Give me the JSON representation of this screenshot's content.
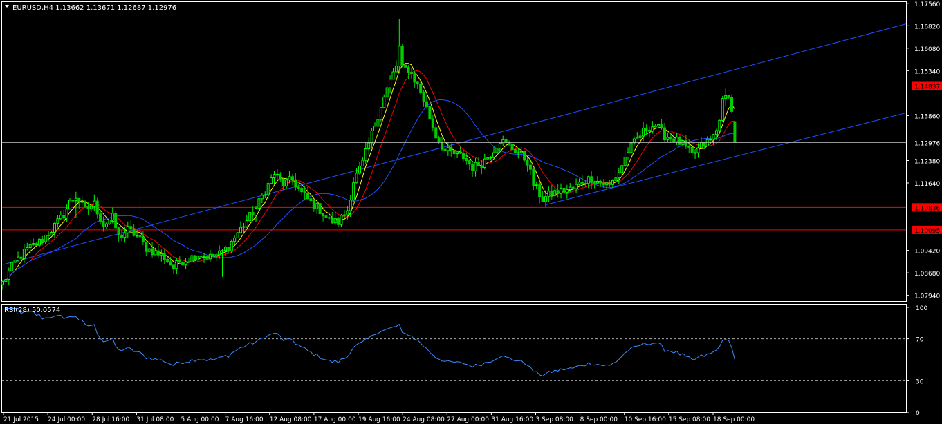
{
  "window": {
    "header_text": "EURUSD,H4  1.13662 1.13671 1.12687 1.12976",
    "rsi_header": "RSI(28) 50.0574"
  },
  "colors": {
    "background": "#000000",
    "frame": "#ffffff",
    "bull_bar": "#00ff00",
    "bear_bar": "#00cc00",
    "ma_fast": "#ffff00",
    "ma_mid": "#ff0000",
    "ma_slow": "#1e50ff",
    "hline": "#ff0000",
    "trendline": "#1e50ff",
    "rsi_line": "#3c8cff",
    "current_price_line": "#c8c8c8",
    "price_tag_bg": "#ff0000"
  },
  "chart_data": [
    {
      "type": "candlestick",
      "title": "EURUSD,H4",
      "symbol": "EURUSD",
      "timeframe": "H4",
      "ohlc_last": {
        "open": 1.13662,
        "high": 1.13671,
        "low": 1.12687,
        "close": 1.12976
      },
      "ylim": [
        1.0775,
        1.176
      ],
      "y_ticks": [
        1.1756,
        1.1682,
        1.1608,
        1.1534,
        1.1386,
        1.1238,
        1.1164,
        1.0942,
        1.0868,
        1.0794
      ],
      "y_tick_labels": [
        "1.17560",
        "1.16820",
        "1.16080",
        "1.15340",
        "1.13860",
        "1.12380",
        "1.11640",
        "1.09420",
        "1.08680",
        "1.07940"
      ],
      "x_tick_labels": [
        "21 Jul 2015",
        "24 Jul 00:00",
        "28 Jul 16:00",
        "31 Jul 08:00",
        "5 Aug 00:00",
        "7 Aug 16:00",
        "12 Aug 08:00",
        "17 Aug 00:00",
        "19 Aug 16:00",
        "24 Aug 08:00",
        "27 Aug 00:00",
        "31 Aug 16:00",
        "3 Sep 08:00",
        "8 Sep 00:00",
        "10 Sep 16:00",
        "15 Sep 08:00",
        "18 Sep 00:00"
      ],
      "horizontal_levels": [
        {
          "value": 1.14837,
          "label": "1.14837"
        },
        {
          "value": 1.10836,
          "label": "1.10836"
        },
        {
          "value": 1.10095,
          "label": "1.10095"
        }
      ],
      "current_price": {
        "value": 1.12976,
        "label": "1.12976"
      },
      "grid": false,
      "price_path": [
        [
          0,
          1.0835
        ],
        [
          4,
          1.0905
        ],
        [
          8,
          1.0945
        ],
        [
          12,
          1.097
        ],
        [
          16,
          1.101
        ],
        [
          20,
          1.106
        ],
        [
          22,
          1.11
        ],
        [
          24,
          1.112
        ],
        [
          27,
          1.1075
        ],
        [
          30,
          1.1095
        ],
        [
          33,
          1.1025
        ],
        [
          36,
          1.105
        ],
        [
          38,
          1.0985
        ],
        [
          41,
          1.101
        ],
        [
          44,
          1.099
        ],
        [
          47,
          1.095
        ],
        [
          50,
          1.0935
        ],
        [
          53,
          1.092
        ],
        [
          56,
          1.0885
        ],
        [
          58,
          1.0905
        ],
        [
          61,
          1.0915
        ],
        [
          64,
          1.093
        ],
        [
          68,
          1.092
        ],
        [
          71,
          1.093
        ],
        [
          74,
          1.0955
        ],
        [
          77,
          1.1
        ],
        [
          80,
          1.104
        ],
        [
          83,
          1.108
        ],
        [
          86,
          1.114
        ],
        [
          89,
          1.1195
        ],
        [
          92,
          1.116
        ],
        [
          95,
          1.1175
        ],
        [
          98,
          1.113
        ],
        [
          101,
          1.11
        ],
        [
          104,
          1.1075
        ],
        [
          107,
          1.104
        ],
        [
          110,
          1.1035
        ],
        [
          113,
          1.1075
        ],
        [
          115,
          1.117
        ],
        [
          118,
          1.123
        ],
        [
          121,
          1.1325
        ],
        [
          124,
          1.142
        ],
        [
          127,
          1.15
        ],
        [
          129,
          1.155
        ],
        [
          130,
          1.161
        ],
        [
          131,
          1.154
        ],
        [
          133,
          1.154
        ],
        [
          135,
          1.1505
        ],
        [
          137,
          1.1465
        ],
        [
          139,
          1.141
        ],
        [
          142,
          1.132
        ],
        [
          145,
          1.127
        ],
        [
          148,
          1.126
        ],
        [
          151,
          1.125
        ],
        [
          154,
          1.1215
        ],
        [
          157,
          1.123
        ],
        [
          160,
          1.126
        ],
        [
          163,
          1.1305
        ],
        [
          166,
          1.1285
        ],
        [
          169,
          1.1265
        ],
        [
          172,
          1.1235
        ],
        [
          174,
          1.116
        ],
        [
          177,
          1.111
        ],
        [
          180,
          1.113
        ],
        [
          184,
          1.114
        ],
        [
          187,
          1.1145
        ],
        [
          190,
          1.117
        ],
        [
          193,
          1.118
        ],
        [
          196,
          1.1165
        ],
        [
          199,
          1.1155
        ],
        [
          202,
          1.12
        ],
        [
          205,
          1.127
        ],
        [
          208,
          1.131
        ],
        [
          211,
          1.1345
        ],
        [
          214,
          1.1355
        ],
        [
          217,
          1.132
        ],
        [
          220,
          1.131
        ],
        [
          223,
          1.129
        ],
        [
          226,
          1.1255
        ],
        [
          229,
          1.1285
        ],
        [
          232,
          1.1305
        ],
        [
          234,
          1.1335
        ],
        [
          236,
          1.143
        ],
        [
          238,
          1.146
        ],
        [
          239,
          1.1395
        ],
        [
          240,
          1.1298
        ]
      ],
      "spikes": [
        [
          24,
          1.1135,
          1.105
        ],
        [
          45,
          1.112,
          1.09
        ],
        [
          72,
          1.0915,
          1.0855
        ],
        [
          130,
          1.1705,
          1.1525
        ],
        [
          178,
          1.109,
          1.1085
        ],
        [
          237,
          1.1475,
          1.1418
        ]
      ],
      "trendlines": [
        {
          "start": [
            0,
            1.0895
          ],
          "end": [
            302,
            1.1688
          ]
        },
        {
          "start": [
            178,
            1.1092
          ],
          "end": [
            302,
            1.1395
          ]
        }
      ],
      "moving_averages": [
        {
          "name": "ma_fast",
          "period": 5
        },
        {
          "name": "ma_mid",
          "period": 10
        },
        {
          "name": "ma_slow",
          "period": 25
        }
      ]
    },
    {
      "type": "line",
      "title": "RSI(28) 50.0574",
      "series": [
        {
          "values": []
        }
      ],
      "last_value": 50.0574,
      "ylim": [
        0,
        100
      ],
      "y_ticks": [
        100,
        70,
        30,
        0
      ],
      "y_tick_labels": [
        "100",
        "70",
        "30",
        "0"
      ],
      "levels": [
        70,
        30
      ]
    }
  ]
}
